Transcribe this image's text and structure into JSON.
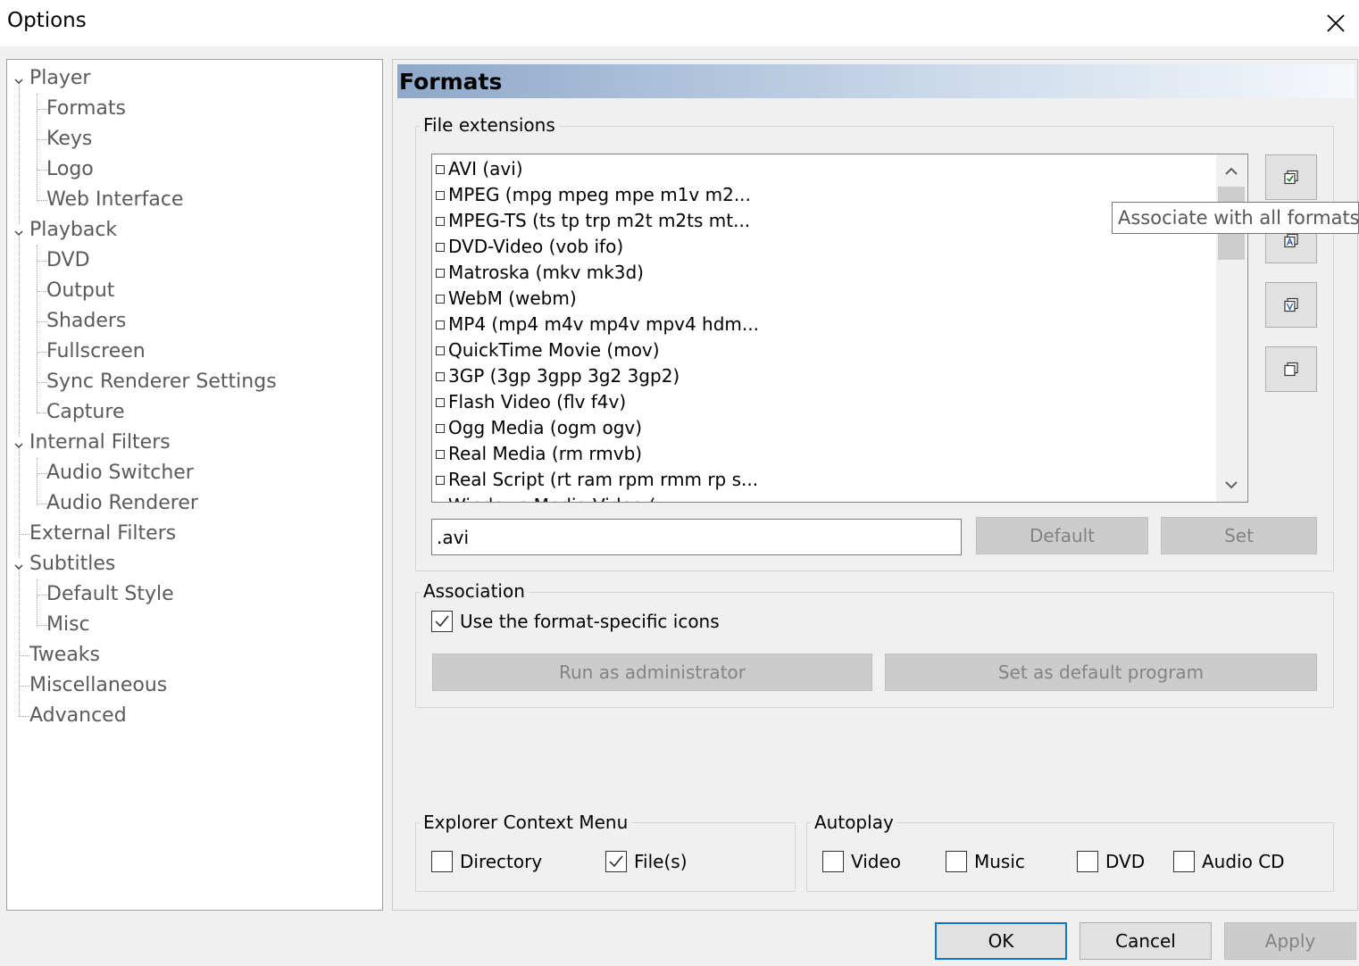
{
  "window": {
    "title": "Options"
  },
  "tree": {
    "items": [
      {
        "label": "Player"
      },
      {
        "label": "Formats"
      },
      {
        "label": "Keys"
      },
      {
        "label": "Logo"
      },
      {
        "label": "Web Interface"
      },
      {
        "label": "Playback"
      },
      {
        "label": "DVD"
      },
      {
        "label": "Output"
      },
      {
        "label": "Shaders"
      },
      {
        "label": "Fullscreen"
      },
      {
        "label": "Sync Renderer Settings"
      },
      {
        "label": "Capture"
      },
      {
        "label": "Internal Filters"
      },
      {
        "label": "Audio Switcher"
      },
      {
        "label": "Audio Renderer"
      },
      {
        "label": "External Filters"
      },
      {
        "label": "Subtitles"
      },
      {
        "label": "Default Style"
      },
      {
        "label": "Misc"
      },
      {
        "label": "Tweaks"
      },
      {
        "label": "Miscellaneous"
      },
      {
        "label": "Advanced"
      }
    ]
  },
  "page": {
    "title": "Formats"
  },
  "file_extensions": {
    "label": "File extensions",
    "items": [
      "AVI (avi)",
      "MPEG (mpg mpeg mpe m1v m2...",
      "MPEG-TS (ts tp trp m2t m2ts mt...",
      "DVD-Video (vob ifo)",
      "Matroska (mkv mk3d)",
      "WebM (webm)",
      "MP4 (mp4 m4v mp4v mpv4 hdm...",
      "QuickTime Movie (mov)",
      "3GP (3gp 3gpp 3g2 3gp2)",
      "Flash Video (flv f4v)",
      "Ogg Media (ogm ogv)",
      "Real Media (rm rmvb)",
      "Real Script (rt ram rpm rmm rp s...",
      "Windows Media Video (..."
    ],
    "extension_value": ".avi",
    "default_label": "Default",
    "set_label": "Set",
    "tooltip": "Associate with all formats"
  },
  "association": {
    "label": "Association",
    "use_icons_label": "Use the format-specific icons",
    "use_icons_checked": true,
    "run_admin_label": "Run as administrator",
    "set_default_label": "Set as default program"
  },
  "explorer_menu": {
    "label": "Explorer Context Menu",
    "directory_label": "Directory",
    "directory_checked": false,
    "files_label": "File(s)",
    "files_checked": true
  },
  "autoplay": {
    "label": "Autoplay",
    "video_label": "Video",
    "music_label": "Music",
    "dvd_label": "DVD",
    "audiocd_label": "Audio CD"
  },
  "buttons": {
    "ok": "OK",
    "cancel": "Cancel",
    "apply": "Apply"
  }
}
